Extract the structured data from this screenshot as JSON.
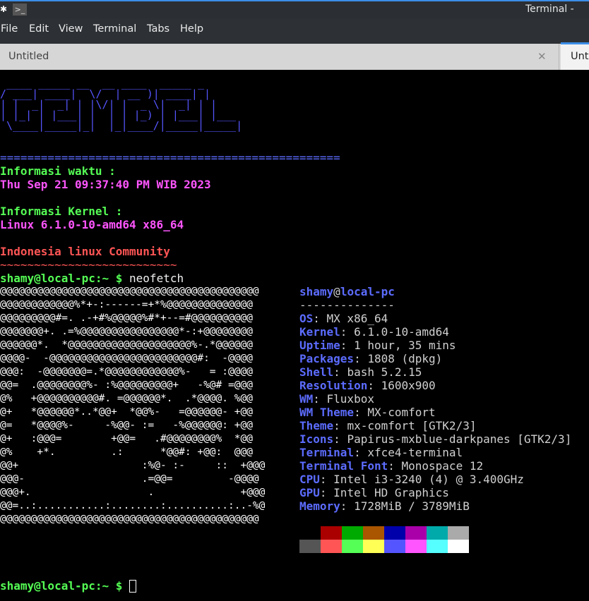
{
  "window": {
    "title": "Terminal -",
    "menu": [
      "File",
      "Edit",
      "View",
      "Terminal",
      "Tabs",
      "Help"
    ],
    "tabs": [
      {
        "label": "Untitled",
        "active": false
      },
      {
        "label": "Untitled",
        "active": true
      }
    ]
  },
  "terminal": {
    "banner": " ____ _____ __  __ ____  _____ _\n/ ___| ____|  \\/  | __ )| ____| |\n| |  _|  _| | |\\/| |  _ \\|  _| | |\n| |_| | |___| |  | | |_) | |___| |___\n \\____|_____|_|  |_|____/|_____|_____|",
    "separator": "==================================================",
    "time_label": "Informasi waktu :",
    "time_value": "Thu Sep 21 09:37:40 PM WIB 2023",
    "kernel_label": "Informasi Kernel :",
    "kernel_value": "Linux 6.1.0-10-amd64 x86_64",
    "community": "Indonesia linux Community",
    "tilde_line": "~~~~~~~~~~~~~~~~~~~~~~~~~~",
    "prompt": "shamy@local-pc:~ $",
    "command": "neofetch",
    "ascii_art": [
      "@@@@@@@@@@@@@@@@@@@@@@@@@@@@@@@@@@@@@@@@@@",
      "@@@@@@@@@@@@%*+-:------=+*%@@@@@@@@@@@@@@",
      "@@@@@@@@@#=. .-+#%@@@@@%#*+--=#@@@@@@@@@@",
      "@@@@@@@+. .=%@@@@@@@@@@@@@@@@*-:+@@@@@@@@",
      "@@@@@@*.  *@@@@@@@@@@@@@@@@@@@@%-.*@@@@@@",
      "@@@@-  -@@@@@@@@@@@@@@@@@@@@@@@@#:  -@@@@",
      "@@@:  -@@@@@@@=.*@@@@@@@@@@@@%-   = :@@@@",
      "@@=  .@@@@@@@@%- :%@@@@@@@@@+   -%@# =@@@",
      "@%   +@@@@@@@@@@#. =@@@@@@*.  .*@@@@. %@@",
      "@+   *@@@@@@*..*@@+  *@@%-   =@@@@@@- +@@",
      "@=   *@@@@%-     -%@@- :=   -%@@@@@@: +@@",
      "@+   :@@@=        +@@=   .#@@@@@@@@%  *@@",
      "@%    +*.         .:      *@@#: +@@:  @@@",
      "@@+                    :%@- :-     ::  +@@@",
      "@@@-                   .=@@=         -@@@@",
      "@@@+.                   .              +@@@",
      "@@=..:...........:........:..........:..-%@",
      "@@@@@@@@@@@@@@@@@@@@@@@@@@@@@@@@@@@@@@@@@@"
    ],
    "neofetch": {
      "user": "shamy",
      "at": "@",
      "host": "local-pc",
      "underline": "--------------",
      "fields": [
        {
          "key": "OS",
          "value": "MX x86_64"
        },
        {
          "key": "Kernel",
          "value": "6.1.0-10-amd64"
        },
        {
          "key": "Uptime",
          "value": "1 hour, 35 mins"
        },
        {
          "key": "Packages",
          "value": "1808 (dpkg)"
        },
        {
          "key": "Shell",
          "value": "bash 5.2.15"
        },
        {
          "key": "Resolution",
          "value": "1600x900"
        },
        {
          "key": "WM",
          "value": "Fluxbox"
        },
        {
          "key": "WM Theme",
          "value": "MX-comfort"
        },
        {
          "key": "Theme",
          "value": "mx-comfort [GTK2/3]"
        },
        {
          "key": "Icons",
          "value": "Papirus-mxblue-darkpanes [GTK2/3]"
        },
        {
          "key": "Terminal",
          "value": "xfce4-terminal"
        },
        {
          "key": "Terminal Font",
          "value": "Monospace 12"
        },
        {
          "key": "CPU",
          "value": "Intel i3-3240 (4) @ 3.400GHz"
        },
        {
          "key": "GPU",
          "value": "Intel HD Graphics"
        },
        {
          "key": "Memory",
          "value": "1728MiB / 3789MiB"
        }
      ],
      "colors_row1": [
        "#000000",
        "#aa0000",
        "#00aa00",
        "#aa5500",
        "#0000aa",
        "#aa00aa",
        "#00aaaa",
        "#aaaaaa"
      ],
      "colors_row2": [
        "#555555",
        "#ff5555",
        "#55ff55",
        "#ffff55",
        "#5555ff",
        "#ff55ff",
        "#55ffff",
        "#ffffff"
      ]
    },
    "final_prompt": "shamy@local-pc:~ $"
  }
}
